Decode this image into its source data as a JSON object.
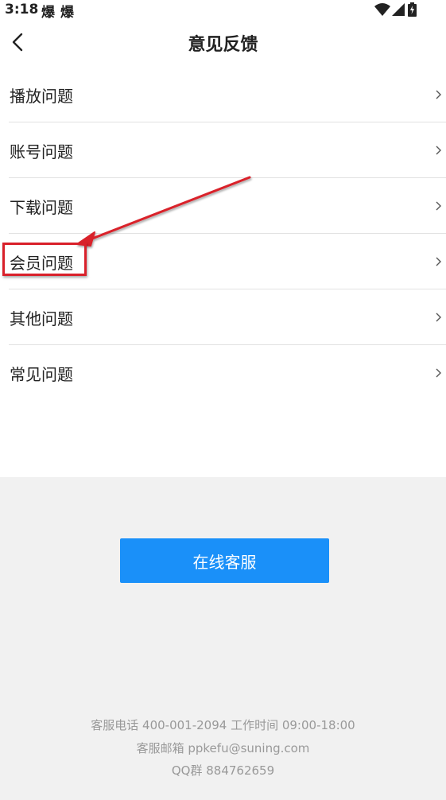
{
  "status_bar": {
    "time": "3:18",
    "notifications": [
      "爆",
      "爆"
    ],
    "icons": [
      "wifi-icon",
      "signal-icon",
      "battery-charging-icon"
    ]
  },
  "header": {
    "back_icon": "chevron-left-icon",
    "title": "意见反馈"
  },
  "menu": {
    "items": [
      {
        "label": "播放问题"
      },
      {
        "label": "账号问题"
      },
      {
        "label": "下载问题"
      },
      {
        "label": "会员问题"
      },
      {
        "label": "其他问题"
      },
      {
        "label": "常见问题"
      }
    ],
    "chevron_icon": "chevron-right-icon"
  },
  "annotation": {
    "highlighted_item": "会员问题",
    "color": "#d9202a"
  },
  "footer": {
    "service_button": "在线客服",
    "phone_line": "客服电话 400-001-2094 工作时间 09:00-18:00",
    "email_line": "客服邮箱 ppkefu@suning.com",
    "qq_line": "QQ群 884762659"
  },
  "colors": {
    "accent": "#1a90f9",
    "bottom_background": "#f1f1f1",
    "footer_text": "#999999"
  }
}
